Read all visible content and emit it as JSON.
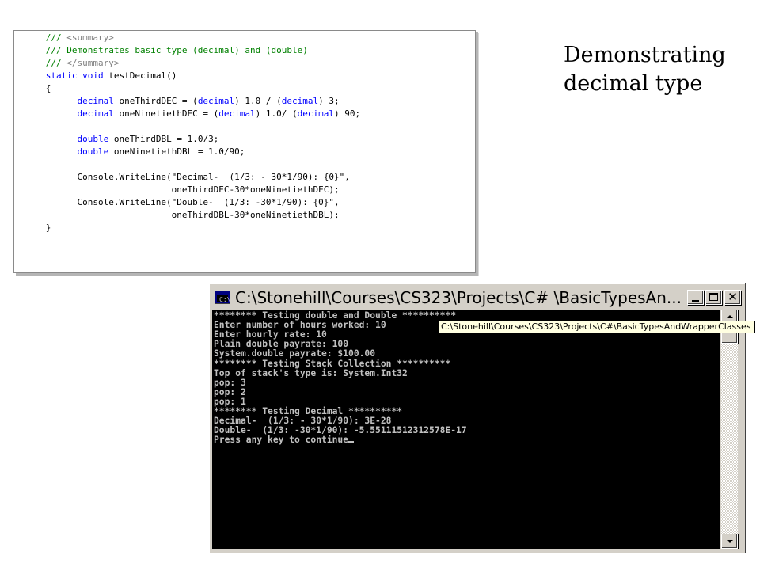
{
  "slide": {
    "title_line1": "Demonstrating",
    "title_line2": "decimal type"
  },
  "code": {
    "lines": [
      [
        {
          "t": "      /// ",
          "c": "green"
        },
        {
          "t": "<summary>",
          "c": "gray"
        }
      ],
      [
        {
          "t": "      /// Demonstrates basic type (decimal) and (double)",
          "c": "green"
        }
      ],
      [
        {
          "t": "      /// ",
          "c": "green"
        },
        {
          "t": "</summary>",
          "c": "gray"
        }
      ],
      [
        {
          "t": "      ",
          "c": "black"
        },
        {
          "t": "static",
          "c": "blue"
        },
        {
          "t": " ",
          "c": "black"
        },
        {
          "t": "void",
          "c": "blue"
        },
        {
          "t": " testDecimal()",
          "c": "black"
        }
      ],
      [
        {
          "t": "      {",
          "c": "black"
        }
      ],
      [
        {
          "t": "            ",
          "c": "black"
        },
        {
          "t": "decimal",
          "c": "blue"
        },
        {
          "t": " oneThirdDEC = (",
          "c": "black"
        },
        {
          "t": "decimal",
          "c": "blue"
        },
        {
          "t": ") 1.0 / (",
          "c": "black"
        },
        {
          "t": "decimal",
          "c": "blue"
        },
        {
          "t": ") 3;",
          "c": "black"
        }
      ],
      [
        {
          "t": "            ",
          "c": "black"
        },
        {
          "t": "decimal",
          "c": "blue"
        },
        {
          "t": " oneNinetiethDEC = (",
          "c": "black"
        },
        {
          "t": "decimal",
          "c": "blue"
        },
        {
          "t": ") 1.0/ (",
          "c": "black"
        },
        {
          "t": "decimal",
          "c": "blue"
        },
        {
          "t": ") 90;",
          "c": "black"
        }
      ],
      [],
      [
        {
          "t": "            ",
          "c": "black"
        },
        {
          "t": "double",
          "c": "blue"
        },
        {
          "t": " oneThirdDBL = 1.0/3;",
          "c": "black"
        }
      ],
      [
        {
          "t": "            ",
          "c": "black"
        },
        {
          "t": "double",
          "c": "blue"
        },
        {
          "t": " oneNinetiethDBL = 1.0/90;",
          "c": "black"
        }
      ],
      [],
      [
        {
          "t": "            Console.WriteLine(\"Decimal-  (1/3: - 30*1/90): {0}\",",
          "c": "black"
        }
      ],
      [
        {
          "t": "                              oneThirdDEC-30*oneNinetiethDEC);",
          "c": "black"
        }
      ],
      [
        {
          "t": "            Console.WriteLine(\"Double-  (1/3: -30*1/90): {0}\",",
          "c": "black"
        }
      ],
      [
        {
          "t": "                              oneThirdDBL-30*oneNinetiethDBL);",
          "c": "black"
        }
      ],
      [
        {
          "t": "      }",
          "c": "black"
        }
      ]
    ],
    "colors": {
      "green": "#008000",
      "gray": "#808080",
      "blue": "#0000ff",
      "black": "#000000"
    }
  },
  "console": {
    "title": "C:\\Stonehill\\Courses\\CS323\\Projects\\C# \\BasicTypesAn...",
    "tooltip": "C:\\Stonehill\\Courses\\CS323\\Projects\\C#\\BasicTypesAndWrapperClasses",
    "app_icon_glyph": "C:\\",
    "lines": [
      "******** Testing double and Double **********",
      "Enter number of hours worked: 10",
      "Enter hourly rate: 10",
      "Plain double payrate: 100",
      "System.double payrate: $100.00",
      "******** Testing Stack Collection **********",
      "Top of stack's type is: System.Int32",
      "pop: 3",
      "pop: 2",
      "pop: 1",
      "******** Testing Decimal **********",
      "Decimal-  (1/3: - 30*1/90): 3E-28",
      "Double-  (1/3: -30*1/90): -5.55111512312578E-17",
      "Press any key to continue"
    ],
    "buttons": {
      "minimize": "minimize-icon",
      "maximize": "maximize-icon",
      "close": "close-icon"
    },
    "close_glyph": "✕"
  }
}
